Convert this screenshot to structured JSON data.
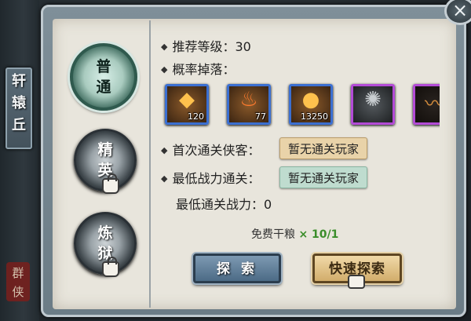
{
  "location": {
    "name": "轩辕丘",
    "seal": "群侠"
  },
  "difficulties": [
    {
      "label": "普通",
      "active": true
    },
    {
      "label": "精英",
      "active": false,
      "locked": true
    },
    {
      "label": "炼狱",
      "active": false,
      "locked": true
    }
  ],
  "recommend": {
    "label": "推荐等级：",
    "value": "30"
  },
  "drops": {
    "label": "概率掉落：",
    "items": [
      {
        "icon": "gold-ingot-icon",
        "count": "120",
        "rarity": "blue"
      },
      {
        "icon": "fire-warrior-icon",
        "count": "77",
        "rarity": "blue"
      },
      {
        "icon": "coin-pile-icon",
        "count": "13250",
        "rarity": "blue"
      },
      {
        "icon": "dark-orb-icon",
        "count": "",
        "rarity": "purple"
      },
      {
        "icon": "root-herb-icon",
        "count": "",
        "rarity": "purple"
      },
      {
        "icon": "jade-gem-icon",
        "count": "",
        "rarity": "blue"
      }
    ]
  },
  "first_clear": {
    "label": "首次通关侠客：",
    "value": "暂无通关玩家"
  },
  "lowest_power": {
    "label": "最低战力通关：",
    "value": "暂无通关玩家"
  },
  "lowest_power_value": {
    "label": "最低通关战力：",
    "value": "0"
  },
  "rations": {
    "label": "免费干粮",
    "count": "× 10/1"
  },
  "buttons": {
    "explore": "探 索",
    "quick_explore": "快速探索"
  },
  "close": "×",
  "colors": {
    "accent_green": "#2f5a4e",
    "rarity_blue": "#3b6fd1",
    "rarity_purple": "#b34bd6"
  }
}
